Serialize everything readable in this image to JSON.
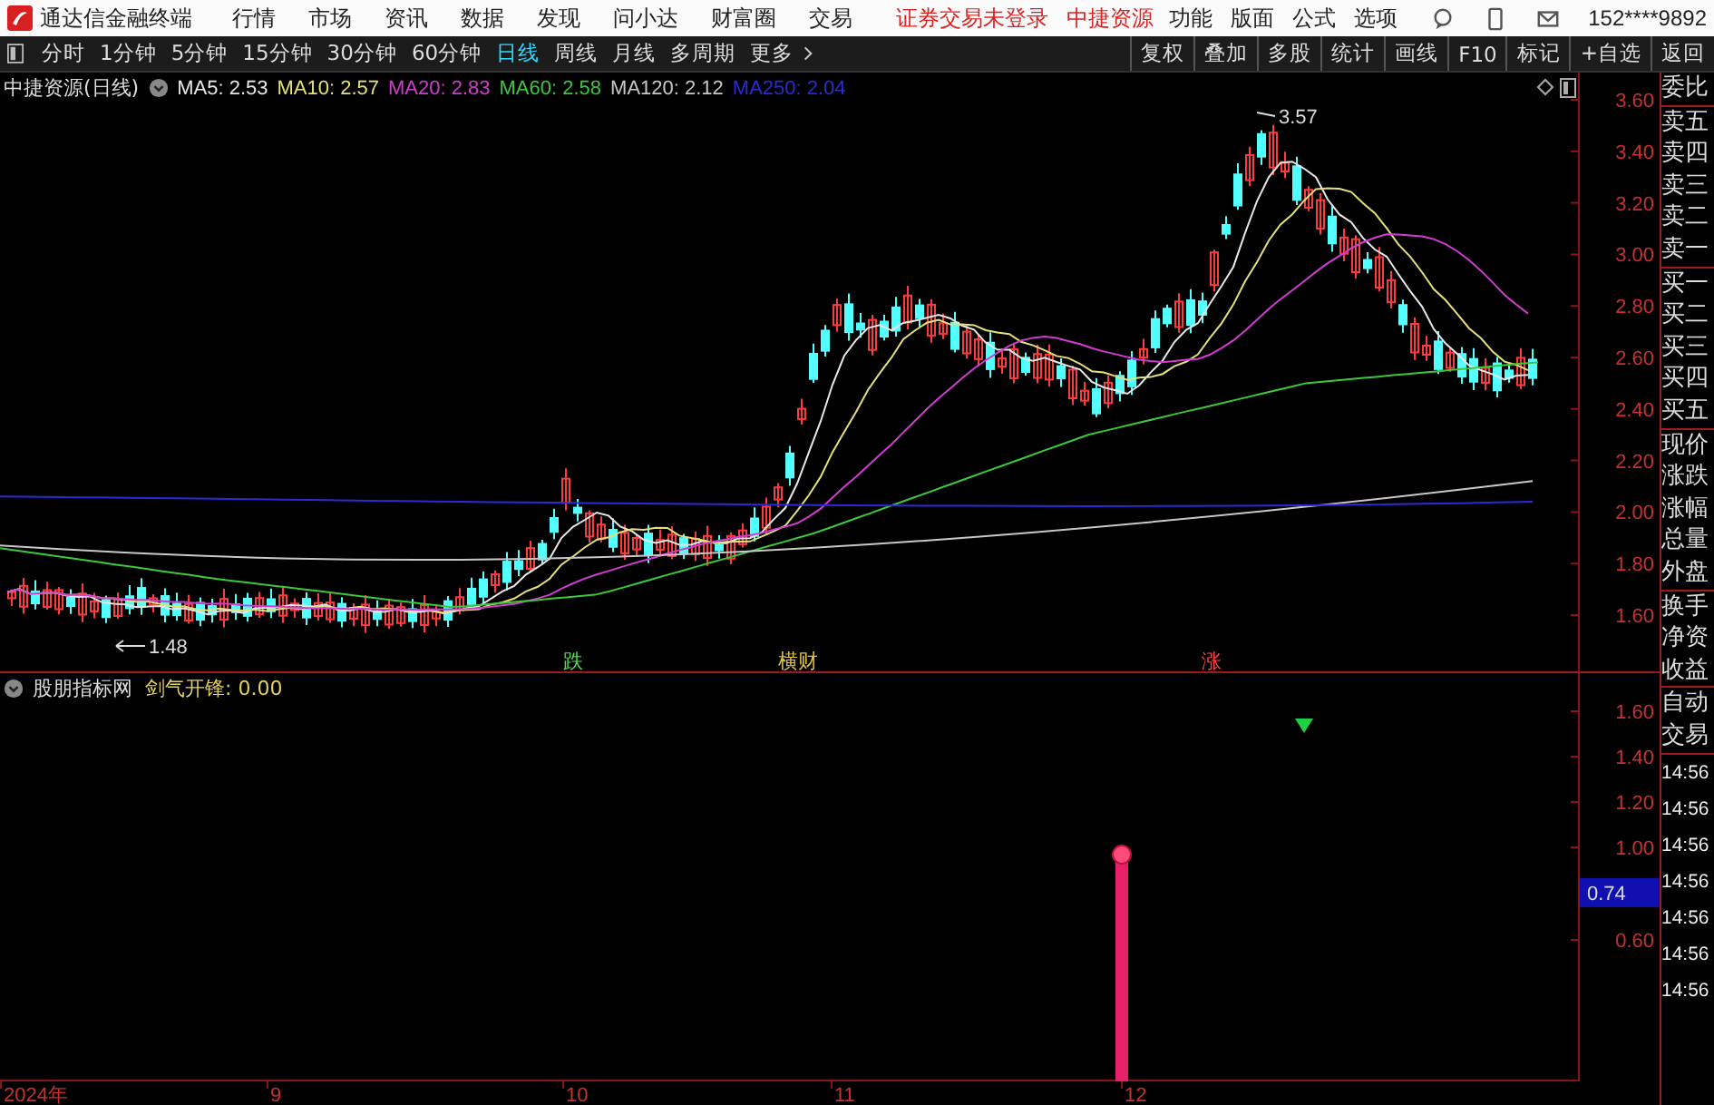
{
  "title_bar": {
    "app_name": "通达信金融终端",
    "menu": [
      "行情",
      "市场",
      "资讯",
      "数据",
      "发现",
      "问小达",
      "财富圈",
      "交易"
    ],
    "notices": [
      "证券交易未登录",
      "中捷资源"
    ],
    "right_menu": [
      "功能",
      "版面",
      "公式",
      "选项"
    ],
    "account": "152****9892"
  },
  "toolbar": {
    "periods": [
      {
        "label": "分时",
        "selected": false
      },
      {
        "label": "1分钟",
        "selected": false
      },
      {
        "label": "5分钟",
        "selected": false
      },
      {
        "label": "15分钟",
        "selected": false
      },
      {
        "label": "30分钟",
        "selected": false
      },
      {
        "label": "60分钟",
        "selected": false
      },
      {
        "label": "日线",
        "selected": true
      },
      {
        "label": "周线",
        "selected": false
      },
      {
        "label": "月线",
        "selected": false
      },
      {
        "label": "多周期",
        "selected": false
      },
      {
        "label": "更多",
        "selected": false
      }
    ],
    "buttons": [
      "复权",
      "叠加",
      "多股",
      "统计",
      "画线",
      "F10",
      "标记",
      "+自选",
      "返回"
    ]
  },
  "main_chart": {
    "title": "中捷资源(日线)",
    "ma": [
      {
        "label": "MA5: 2.53",
        "color": "#e8e8e8"
      },
      {
        "label": "MA10: 2.57",
        "color": "#e6e07a"
      },
      {
        "label": "MA20: 2.83",
        "color": "#d23cd2"
      },
      {
        "label": "MA60: 2.58",
        "color": "#3cc83c"
      },
      {
        "label": "MA120: 2.12",
        "color": "#c8c8c8"
      },
      {
        "label": "MA250: 2.04",
        "color": "#2a2ad8"
      }
    ],
    "price_axis": [
      "3.60",
      "3.40",
      "3.20",
      "3.00",
      "2.80",
      "2.60",
      "2.40",
      "2.20",
      "2.00",
      "1.80",
      "1.60"
    ],
    "high_label": "3.57",
    "low_label": "1.48",
    "signals": [
      {
        "text": "跌",
        "color": "#50e050"
      },
      {
        "text": "横财",
        "color": "#e0c040"
      },
      {
        "text": "涨",
        "color": "#ff4040"
      }
    ]
  },
  "indicator": {
    "title": "股朋指标网",
    "formula": "剑气开锋: 0.00",
    "axis": [
      "1.60",
      "1.40",
      "1.20",
      "1.00",
      "0.60"
    ],
    "current_value": "0.74"
  },
  "quote_panel": {
    "groups": [
      [
        "委比"
      ],
      [
        "卖五",
        "卖四",
        "卖三",
        "卖二",
        "卖一"
      ],
      [
        "买一",
        "买二",
        "买三",
        "买四",
        "买五"
      ],
      [
        "现价",
        "涨跌",
        "涨幅",
        "总量",
        "外盘"
      ],
      [
        "换手",
        "净资",
        "收益"
      ]
    ],
    "trade_labels": [
      "自动",
      "交易"
    ],
    "times": [
      "14:56",
      "14:56",
      "14:56",
      "14:56",
      "14:56",
      "14:56",
      "14:56"
    ]
  },
  "time_axis": [
    "2024年",
    "9",
    "10",
    "11",
    "12"
  ]
}
